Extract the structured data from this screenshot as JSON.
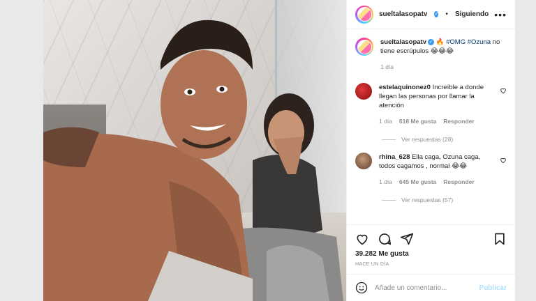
{
  "header": {
    "username": "sueltalasopatv",
    "follow_status": "Siguiendo",
    "more_label": "•••"
  },
  "caption": {
    "username": "sueltalasopatv",
    "emoji": "🔥",
    "hashtag1": "#OMG",
    "hashtag2": "#Ozuna",
    "text": "no tiene escrúpulos 😂😂😂",
    "time": "1 día"
  },
  "comments": [
    {
      "username": "estelaquinonez0",
      "text": "Increíble a donde llegan las personas por llamar la atención",
      "time": "1 día",
      "likes": "618 Me gusta",
      "reply": "Responder",
      "view_replies": "Ver respuestas (28)"
    },
    {
      "username": "rhina_628",
      "text": "Ella caga, Ozuna caga, todos cagamos , normal 😂😂",
      "time": "1 día",
      "likes": "645 Me gusta",
      "reply": "Responder",
      "view_replies": "Ver respuestas (57)"
    }
  ],
  "post": {
    "likes": "39.282 Me gusta",
    "time": "HACE UN DÍA"
  },
  "add_comment": {
    "placeholder": "Añade un comentario...",
    "publish": "Publicar"
  },
  "icons": {
    "like": "heart-icon",
    "comment": "comment-icon",
    "share": "share-icon",
    "save": "bookmark-icon",
    "emoji": "emoji-icon"
  },
  "colors": {
    "link": "#00376b",
    "verified": "#3897f0",
    "muted": "#8e8e8e",
    "publish": "#b2dffc"
  }
}
